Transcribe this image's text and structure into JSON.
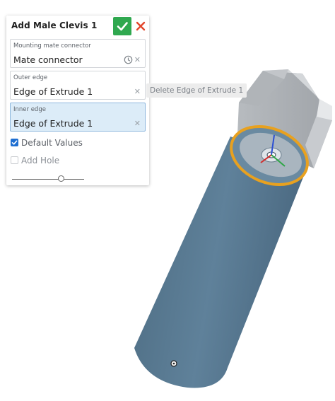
{
  "dialog": {
    "title": "Add Male Clevis 1",
    "accept_icon": "checkmark-icon",
    "cancel_icon": "close-icon",
    "colors": {
      "accept": "#2fa84f",
      "cancel": "#e2452b",
      "active_field": "#dcecf8"
    }
  },
  "fields": [
    {
      "label": "Mounting mate connector",
      "value": "Mate connector",
      "icon": "clock-icon",
      "active": false
    },
    {
      "label": "Outer edge",
      "value": "Edge of Extrude 1",
      "active": false
    },
    {
      "label": "Inner edge",
      "value": "Edge of Extrude 1",
      "active": true
    }
  ],
  "options": {
    "default_values": {
      "label": "Default Values",
      "checked": true
    },
    "add_hole": {
      "label": "Add Hole",
      "checked": false
    }
  },
  "slider": {
    "value": 0.7
  },
  "tooltip": {
    "text": "Delete Edge of Extrude 1"
  },
  "viewport": {
    "model_colors": {
      "cylinder": "#5a7c94",
      "cap": "#bfc3c7",
      "selection": "#e8a11f"
    }
  }
}
